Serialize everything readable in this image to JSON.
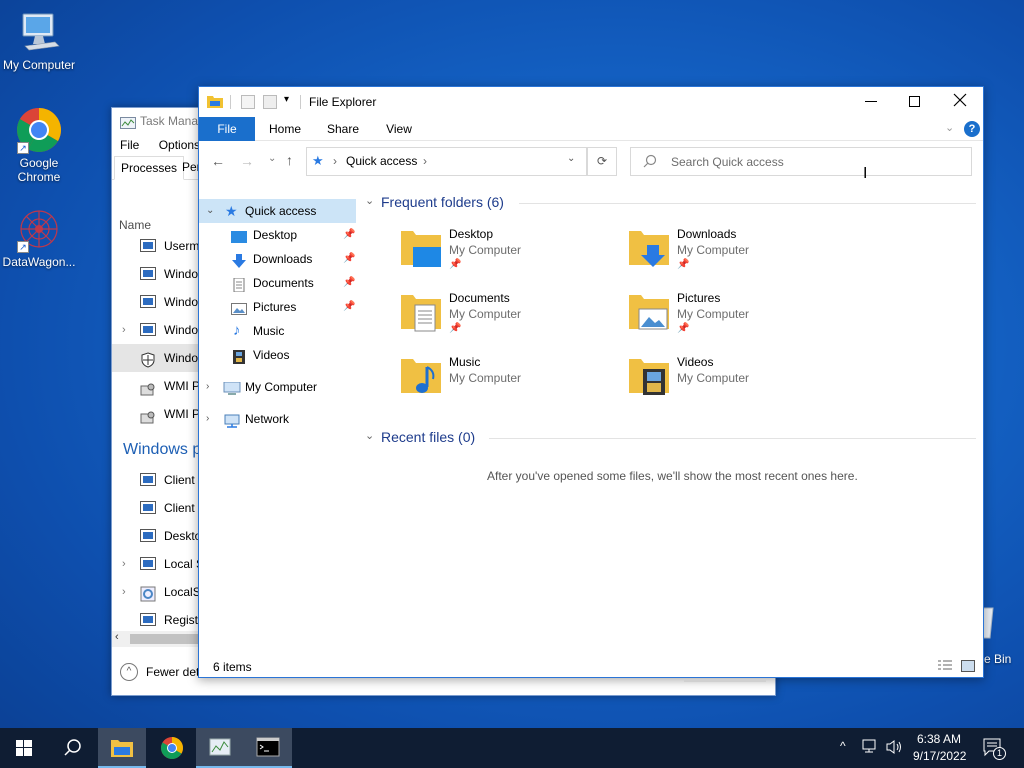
{
  "desktop": {
    "icons": [
      {
        "label": "My Computer"
      },
      {
        "label": "Google Chrome"
      },
      {
        "label": "DataWagon..."
      }
    ],
    "recycle_partial": "e Bin"
  },
  "task_manager": {
    "title": "Task Manag",
    "menu": [
      "File",
      "Options"
    ],
    "tabs": [
      "Processes",
      "Per"
    ],
    "column_name": "Name",
    "rows": [
      {
        "label": "Userm",
        "expand": false
      },
      {
        "label": "Windo",
        "expand": false
      },
      {
        "label": "Windo",
        "expand": false
      },
      {
        "label": "Windo",
        "expand": true
      },
      {
        "label": "Windo",
        "expand": false
      },
      {
        "label": "WMI P",
        "expand": false
      },
      {
        "label": "WMI P",
        "expand": false
      }
    ],
    "section_header": "Windows p",
    "rows2": [
      {
        "label": "Client",
        "expand": false
      },
      {
        "label": "Client",
        "expand": false
      },
      {
        "label": "Deskto",
        "expand": false
      },
      {
        "label": "Local S",
        "expand": true
      },
      {
        "label": "LocalS",
        "expand": true
      },
      {
        "label": "Registr",
        "expand": false
      }
    ],
    "fewer_details": "Fewer det"
  },
  "file_explorer": {
    "title": "File Explorer",
    "ribbon_tabs": [
      "File",
      "Home",
      "Share",
      "View"
    ],
    "address": "Quick access",
    "search_placeholder": "Search Quick access",
    "nav": {
      "quick_access": "Quick access",
      "pinned": [
        "Desktop",
        "Downloads",
        "Documents",
        "Pictures"
      ],
      "unpinned": [
        "Music",
        "Videos"
      ],
      "my_computer": "My Computer",
      "network": "Network"
    },
    "frequent_header": "Frequent folders (6)",
    "folders": [
      {
        "name": "Desktop",
        "location": "My Computer",
        "pinned": true,
        "icon": "desktop-folder-icon"
      },
      {
        "name": "Downloads",
        "location": "My Computer",
        "pinned": true,
        "icon": "downloads-folder-icon"
      },
      {
        "name": "Documents",
        "location": "My Computer",
        "pinned": true,
        "icon": "documents-folder-icon"
      },
      {
        "name": "Pictures",
        "location": "My Computer",
        "pinned": true,
        "icon": "pictures-folder-icon"
      },
      {
        "name": "Music",
        "location": "My Computer",
        "pinned": false,
        "icon": "music-folder-icon"
      },
      {
        "name": "Videos",
        "location": "My Computer",
        "pinned": false,
        "icon": "videos-folder-icon"
      }
    ],
    "recent_header": "Recent files (0)",
    "recent_empty": "After you've opened some files, we'll show the most recent ones here.",
    "status": "6 items"
  },
  "taskbar": {
    "time": "6:38 AM",
    "date": "9/17/2022",
    "notification_count": "1"
  },
  "colors": {
    "accent": "#1a6fcc",
    "taskbar": "#0f1d33",
    "selection": "#cce4f7"
  }
}
